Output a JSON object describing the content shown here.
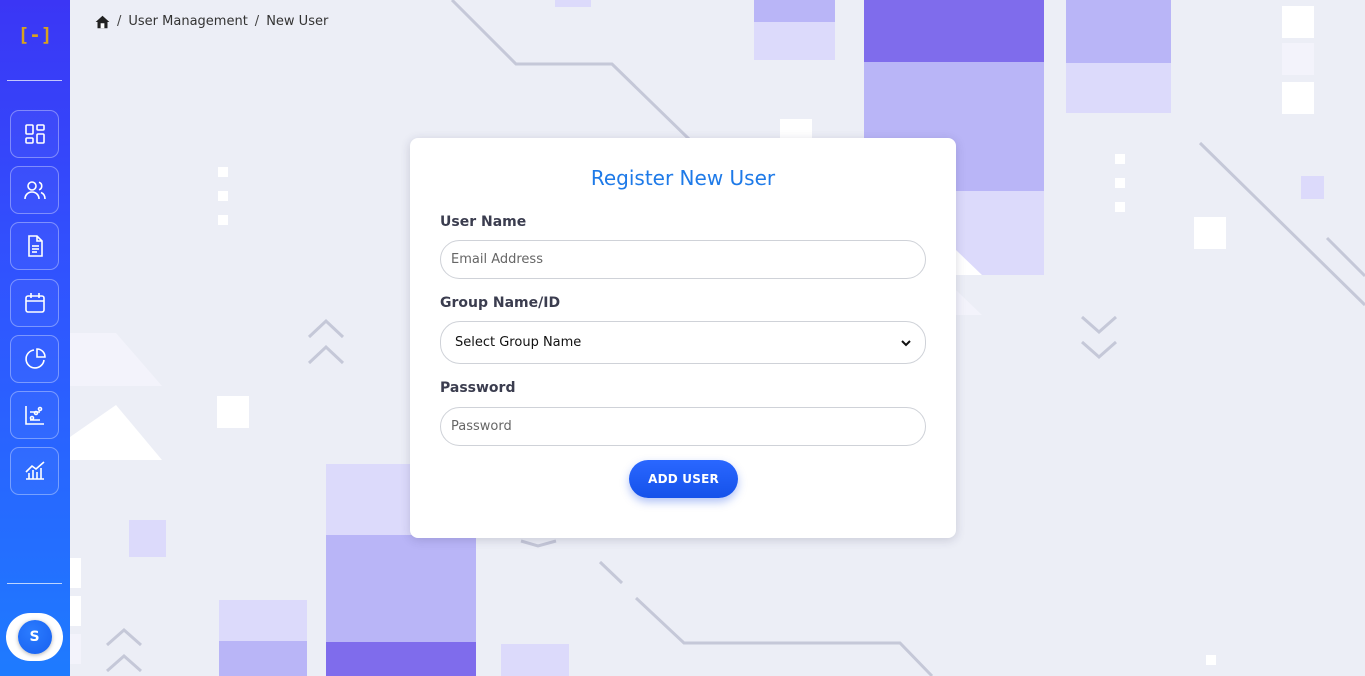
{
  "sidebar": {
    "logo": "[-]",
    "nav": [
      {
        "icon": "dashboard-icon"
      },
      {
        "icon": "users-icon"
      },
      {
        "icon": "document-icon"
      },
      {
        "icon": "calendar-icon"
      },
      {
        "icon": "pie-chart-icon"
      },
      {
        "icon": "scatter-chart-icon"
      },
      {
        "icon": "bar-line-chart-icon"
      }
    ],
    "avatar_initial": "S"
  },
  "breadcrumb": {
    "home_icon": "home-icon",
    "items": [
      "User Management",
      "New User"
    ],
    "separator": "/"
  },
  "form": {
    "title": "Register New User",
    "username_label": "User Name",
    "username_placeholder": "Email Address",
    "username_value": "",
    "group_label": "Group Name/ID",
    "group_selected": "Select Group Name",
    "password_label": "Password",
    "password_placeholder": "Password",
    "password_value": "",
    "submit_label": "ADD USER"
  },
  "colors": {
    "sidebar_gradient_top": "#3b36f5",
    "sidebar_gradient_bottom": "#1e7bff",
    "title_blue": "#1e7ae8",
    "button_blue": "#1552ea",
    "background": "#eceef6",
    "logo_gold": "#d8a21e"
  }
}
